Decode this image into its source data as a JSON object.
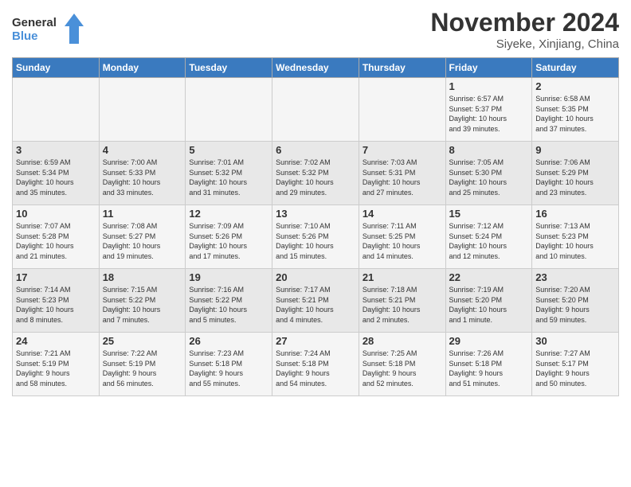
{
  "header": {
    "logo_line1": "General",
    "logo_line2": "Blue",
    "month": "November 2024",
    "location": "Siyeke, Xinjiang, China"
  },
  "weekdays": [
    "Sunday",
    "Monday",
    "Tuesday",
    "Wednesday",
    "Thursday",
    "Friday",
    "Saturday"
  ],
  "weeks": [
    [
      {
        "day": "",
        "info": ""
      },
      {
        "day": "",
        "info": ""
      },
      {
        "day": "",
        "info": ""
      },
      {
        "day": "",
        "info": ""
      },
      {
        "day": "",
        "info": ""
      },
      {
        "day": "1",
        "info": "Sunrise: 6:57 AM\nSunset: 5:37 PM\nDaylight: 10 hours\nand 39 minutes."
      },
      {
        "day": "2",
        "info": "Sunrise: 6:58 AM\nSunset: 5:35 PM\nDaylight: 10 hours\nand 37 minutes."
      }
    ],
    [
      {
        "day": "3",
        "info": "Sunrise: 6:59 AM\nSunset: 5:34 PM\nDaylight: 10 hours\nand 35 minutes."
      },
      {
        "day": "4",
        "info": "Sunrise: 7:00 AM\nSunset: 5:33 PM\nDaylight: 10 hours\nand 33 minutes."
      },
      {
        "day": "5",
        "info": "Sunrise: 7:01 AM\nSunset: 5:32 PM\nDaylight: 10 hours\nand 31 minutes."
      },
      {
        "day": "6",
        "info": "Sunrise: 7:02 AM\nSunset: 5:32 PM\nDaylight: 10 hours\nand 29 minutes."
      },
      {
        "day": "7",
        "info": "Sunrise: 7:03 AM\nSunset: 5:31 PM\nDaylight: 10 hours\nand 27 minutes."
      },
      {
        "day": "8",
        "info": "Sunrise: 7:05 AM\nSunset: 5:30 PM\nDaylight: 10 hours\nand 25 minutes."
      },
      {
        "day": "9",
        "info": "Sunrise: 7:06 AM\nSunset: 5:29 PM\nDaylight: 10 hours\nand 23 minutes."
      }
    ],
    [
      {
        "day": "10",
        "info": "Sunrise: 7:07 AM\nSunset: 5:28 PM\nDaylight: 10 hours\nand 21 minutes."
      },
      {
        "day": "11",
        "info": "Sunrise: 7:08 AM\nSunset: 5:27 PM\nDaylight: 10 hours\nand 19 minutes."
      },
      {
        "day": "12",
        "info": "Sunrise: 7:09 AM\nSunset: 5:26 PM\nDaylight: 10 hours\nand 17 minutes."
      },
      {
        "day": "13",
        "info": "Sunrise: 7:10 AM\nSunset: 5:26 PM\nDaylight: 10 hours\nand 15 minutes."
      },
      {
        "day": "14",
        "info": "Sunrise: 7:11 AM\nSunset: 5:25 PM\nDaylight: 10 hours\nand 14 minutes."
      },
      {
        "day": "15",
        "info": "Sunrise: 7:12 AM\nSunset: 5:24 PM\nDaylight: 10 hours\nand 12 minutes."
      },
      {
        "day": "16",
        "info": "Sunrise: 7:13 AM\nSunset: 5:23 PM\nDaylight: 10 hours\nand 10 minutes."
      }
    ],
    [
      {
        "day": "17",
        "info": "Sunrise: 7:14 AM\nSunset: 5:23 PM\nDaylight: 10 hours\nand 8 minutes."
      },
      {
        "day": "18",
        "info": "Sunrise: 7:15 AM\nSunset: 5:22 PM\nDaylight: 10 hours\nand 7 minutes."
      },
      {
        "day": "19",
        "info": "Sunrise: 7:16 AM\nSunset: 5:22 PM\nDaylight: 10 hours\nand 5 minutes."
      },
      {
        "day": "20",
        "info": "Sunrise: 7:17 AM\nSunset: 5:21 PM\nDaylight: 10 hours\nand 4 minutes."
      },
      {
        "day": "21",
        "info": "Sunrise: 7:18 AM\nSunset: 5:21 PM\nDaylight: 10 hours\nand 2 minutes."
      },
      {
        "day": "22",
        "info": "Sunrise: 7:19 AM\nSunset: 5:20 PM\nDaylight: 10 hours\nand 1 minute."
      },
      {
        "day": "23",
        "info": "Sunrise: 7:20 AM\nSunset: 5:20 PM\nDaylight: 9 hours\nand 59 minutes."
      }
    ],
    [
      {
        "day": "24",
        "info": "Sunrise: 7:21 AM\nSunset: 5:19 PM\nDaylight: 9 hours\nand 58 minutes."
      },
      {
        "day": "25",
        "info": "Sunrise: 7:22 AM\nSunset: 5:19 PM\nDaylight: 9 hours\nand 56 minutes."
      },
      {
        "day": "26",
        "info": "Sunrise: 7:23 AM\nSunset: 5:18 PM\nDaylight: 9 hours\nand 55 minutes."
      },
      {
        "day": "27",
        "info": "Sunrise: 7:24 AM\nSunset: 5:18 PM\nDaylight: 9 hours\nand 54 minutes."
      },
      {
        "day": "28",
        "info": "Sunrise: 7:25 AM\nSunset: 5:18 PM\nDaylight: 9 hours\nand 52 minutes."
      },
      {
        "day": "29",
        "info": "Sunrise: 7:26 AM\nSunset: 5:18 PM\nDaylight: 9 hours\nand 51 minutes."
      },
      {
        "day": "30",
        "info": "Sunrise: 7:27 AM\nSunset: 5:17 PM\nDaylight: 9 hours\nand 50 minutes."
      }
    ]
  ]
}
